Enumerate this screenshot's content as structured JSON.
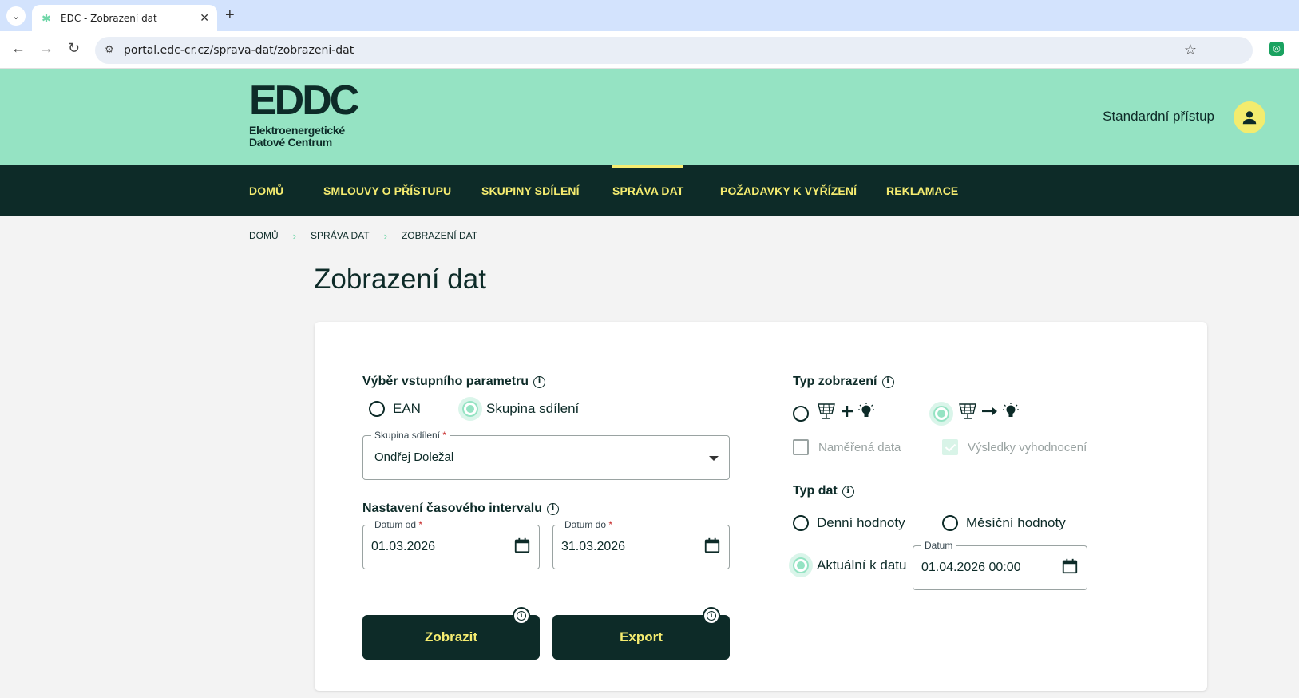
{
  "browser": {
    "tab_title": "EDC - Zobrazení dat",
    "url": "portal.edc-cr.cz/sprava-dat/zobrazeni-dat"
  },
  "header": {
    "logo_mark": "EDDC",
    "logo_line1": "Elektroenergetické",
    "logo_line2": "Datové Centrum",
    "access_label": "Standardní přístup"
  },
  "nav": {
    "items": [
      {
        "label": "DOMŮ"
      },
      {
        "label": "SMLOUVY O PŘÍSTUPU"
      },
      {
        "label": "SKUPINY SDÍLENÍ"
      },
      {
        "label": "SPRÁVA DAT"
      },
      {
        "label": "POŽADAVKY K VYŘÍZENÍ"
      },
      {
        "label": "REKLAMACE"
      }
    ],
    "active": "SPRÁVA DAT"
  },
  "breadcrumb": [
    "DOMŮ",
    "SPRÁVA DAT",
    "ZOBRAZENÍ DAT"
  ],
  "page_title": "Zobrazení dat",
  "form": {
    "input_param": {
      "label": "Výběr vstupního parametru",
      "options": [
        "EAN",
        "Skupina sdílení"
      ],
      "selected": "Skupina sdílení"
    },
    "group_select": {
      "label": "Skupina sdílení",
      "required_mark": "*",
      "value": "Ondřej Doležal"
    },
    "interval": {
      "label": "Nastavení časového intervalu",
      "from_label": "Datum od",
      "from_value": "01.03.2026",
      "to_label": "Datum do",
      "to_value": "31.03.2026",
      "required_mark": "*"
    },
    "buttons": {
      "show": "Zobrazit",
      "export": "Export"
    },
    "display_type": {
      "label": "Typ zobrazení",
      "options": [
        {
          "caption": "Naměřená data",
          "selected": false
        },
        {
          "caption": "Výsledky vyhodnocení",
          "selected": true
        }
      ]
    },
    "data_type": {
      "label": "Typ dat",
      "options": [
        "Denní hodnoty",
        "Měsíční hodnoty",
        "Aktuální k datu"
      ],
      "selected": "Aktuální k datu",
      "date_label": "Datum",
      "date_value": "01.04.2026 00:00"
    }
  },
  "colors": {
    "brand_mint": "#95e3c3",
    "brand_dark": "#0d2b28",
    "accent_yellow": "#f5ec70"
  }
}
